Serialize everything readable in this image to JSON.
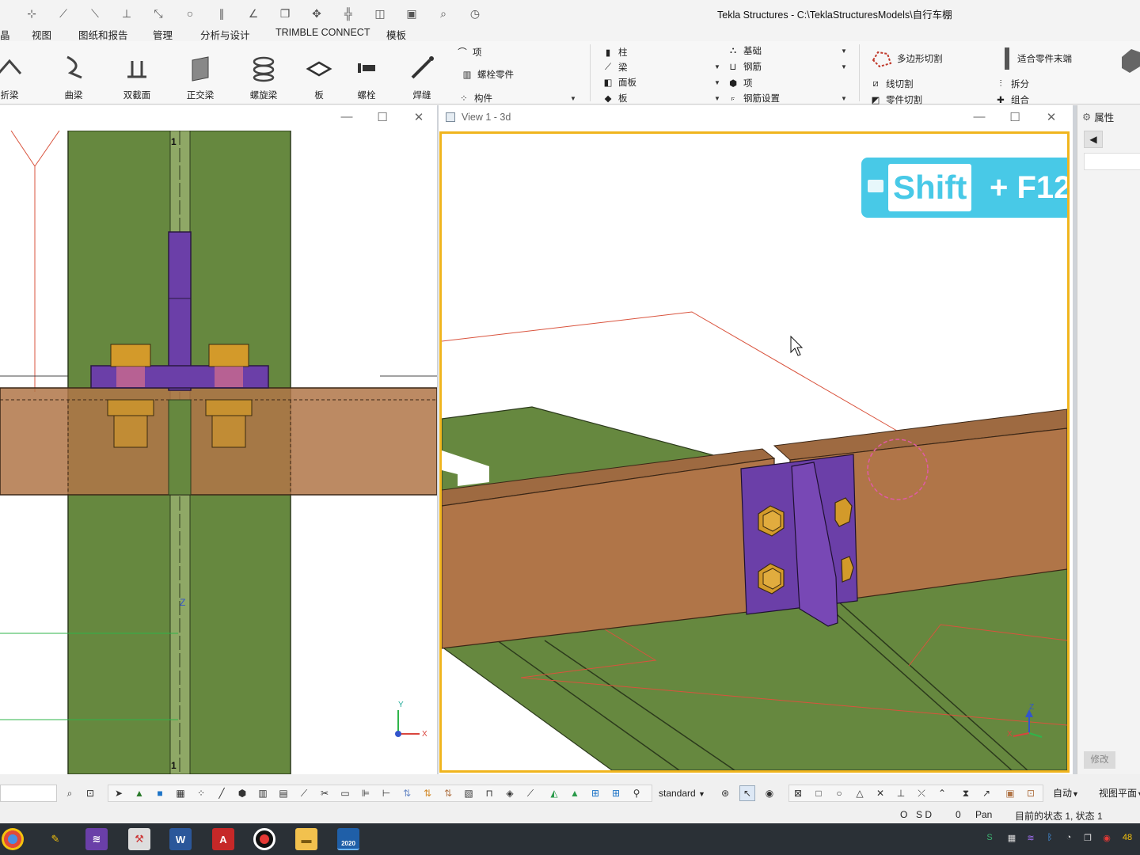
{
  "window": {
    "title": "Tekla Structures - C:\\TeklaStructuresModels\\自行车棚"
  },
  "menu": {
    "items": [
      "视图",
      "图纸和报告",
      "管理",
      "分析与设计",
      "TRIMBLE CONNECT",
      "模板"
    ],
    "partial_first": "晶"
  },
  "ribbon": {
    "big_buttons": [
      "折梁",
      "曲梁",
      "双截面",
      "正交梁",
      "螺旋梁",
      "板",
      "螺栓",
      "焊缝"
    ],
    "group1": {
      "item": "项",
      "bolt_parts": "螺栓零件",
      "component": "构件"
    },
    "group2": {
      "column": "柱",
      "beam": "梁",
      "panel": "面板",
      "plate": "板",
      "foundation": "基础",
      "rebar": "钢筋",
      "item": "项",
      "rebar_set": "钢筋设置"
    },
    "group3": {
      "polygon_cut": "多边形切割",
      "fit_part_end": "适合零件末端",
      "line_cut": "线切割",
      "split": "拆分",
      "part_cut": "零件切割",
      "combine": "组合"
    }
  },
  "views": {
    "left": {
      "grid_label_top": "1",
      "grid_label_bottom": "1",
      "axis_z": "Z",
      "coord": {
        "y": "Y",
        "x": "X"
      }
    },
    "right": {
      "title": "View 1 - 3d",
      "shortcut_key1": "Shift",
      "shortcut_plus": "+ F12",
      "coord": {
        "z": "Z",
        "x": "X"
      }
    }
  },
  "properties": {
    "title": "属性",
    "modify_button": "修改"
  },
  "bottom_toolbar": {
    "view_style": "standard",
    "snap_mode": "自动",
    "view_plane": "视图平面"
  },
  "status": {
    "o": "O",
    "sd": "S D",
    "zero": "0",
    "pan": "Pan",
    "state": "目前的状态 1, 状态 1"
  },
  "taskbar": {
    "tekla_year": "2020",
    "clock_partial": "48"
  },
  "colors": {
    "beam": "#b07548",
    "plate_green": "#64893c",
    "plate_purple": "#6b3fa8",
    "bolt_gold": "#d39a2a",
    "active_border": "#f0b51e",
    "shortcut_bg": "#39c5e6"
  }
}
